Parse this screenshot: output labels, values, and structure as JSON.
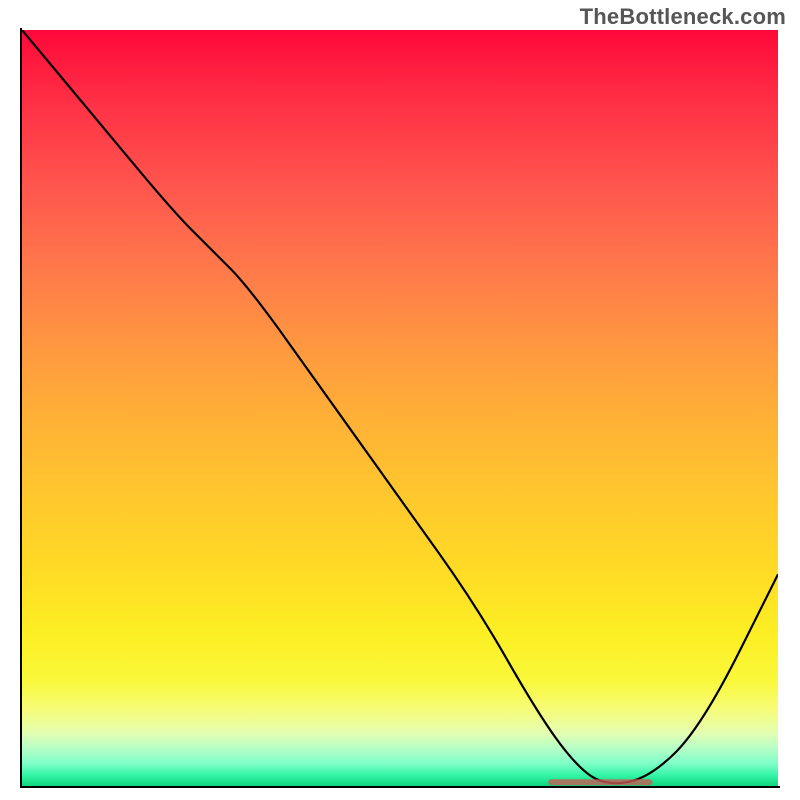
{
  "watermark": "TheBottleneck.com",
  "chart_data": {
    "type": "line",
    "title": "",
    "xlabel": "",
    "ylabel": "",
    "xlim": [
      0,
      100
    ],
    "ylim": [
      0,
      100
    ],
    "grid": false,
    "x": [
      0,
      10,
      20,
      25,
      30,
      40,
      50,
      60,
      68,
      73,
      77,
      83,
      90,
      100
    ],
    "values": [
      100,
      88,
      76,
      71,
      66,
      52,
      38,
      24,
      10,
      3,
      0,
      1,
      8,
      28
    ],
    "flat_segment": {
      "x_start": 70,
      "x_end": 83,
      "y": 0.5
    },
    "gradient_stops": [
      {
        "pos": 0.0,
        "color": "#ff083a"
      },
      {
        "pos": 0.5,
        "color": "#ffb236"
      },
      {
        "pos": 0.85,
        "color": "#faf83a"
      },
      {
        "pos": 1.0,
        "color": "#0cd47e"
      }
    ]
  }
}
